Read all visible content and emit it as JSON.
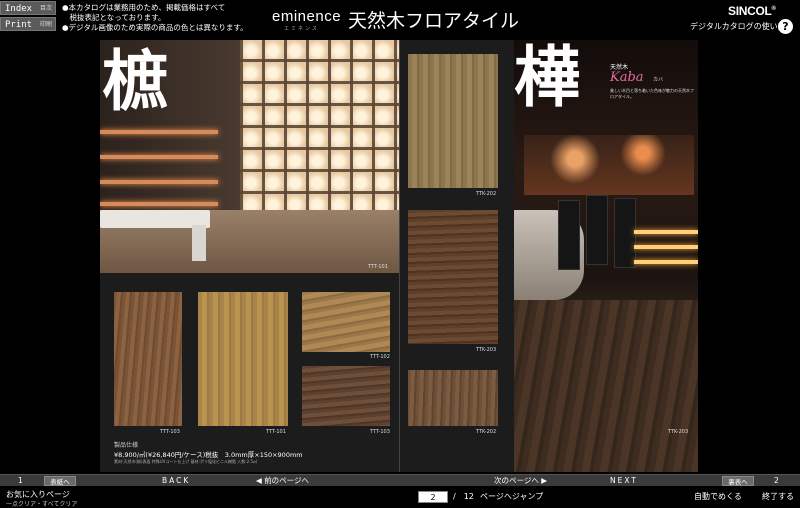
{
  "header": {
    "index_label": "Index",
    "index_sub": "目次",
    "print_label": "Print",
    "print_sub": "印刷",
    "notice_lines": [
      "●本カタログは業務用のため、掲載価格はすべて",
      "　税抜表記となっております。",
      "●デジタル画像のため実際の商品の色とは異なります。"
    ],
    "brand": "eminence",
    "brand_sub": "エミネンス",
    "title": "天然木フロアタイル",
    "logo": "SINCOL",
    "howto": "デジタルカタログの使い方",
    "help_glyph": "?"
  },
  "spread": {
    "left": {
      "kanji": "樜",
      "hero_code": "TTT-101",
      "swatches": [
        {
          "code": "TTT-103"
        },
        {
          "code": "TTT-101"
        },
        {
          "code": "TTT-102"
        },
        {
          "code": "TTT-103"
        }
      ],
      "spec_title": "製品仕様",
      "spec_price": "¥8,900/㎡(¥26,840円/ケース)税抜　3.0mm厚×150×900mm",
      "spec_note": "素材:天然木(樜)表面 特殊UVコート仕上げ 基材:ポリ塩化ビニル樹脂 入数:2.5㎡"
    },
    "right": {
      "kanji": "樺",
      "kaba_small": "天然木",
      "kaba_name": "Kaba",
      "kaba_sub": "カバ",
      "kaba_desc": "美しい木目と落ち着いた色味が魅力の天然木フロアタイル。",
      "swatches": [
        {
          "code": "TTK-202"
        },
        {
          "code": "TTK-203"
        },
        {
          "code": "TTK-202"
        }
      ],
      "hero_code": "TTK-203"
    }
  },
  "nav": {
    "page_left": "1",
    "cover_label": "表紙へ",
    "back": "BACK",
    "prev": "◀ 前のページへ",
    "next_page": "次のページへ ▶",
    "next": "NEXT",
    "last_label": "裏表へ",
    "page_right": "2"
  },
  "footer": {
    "favorites": "お気に入りページ",
    "favorites_sub": "一点クリア・すべてクリア",
    "current_page": "2",
    "total": "/　12",
    "jump": "ページへジャンプ",
    "auto": "自動でめくる",
    "quit": "終了する"
  }
}
